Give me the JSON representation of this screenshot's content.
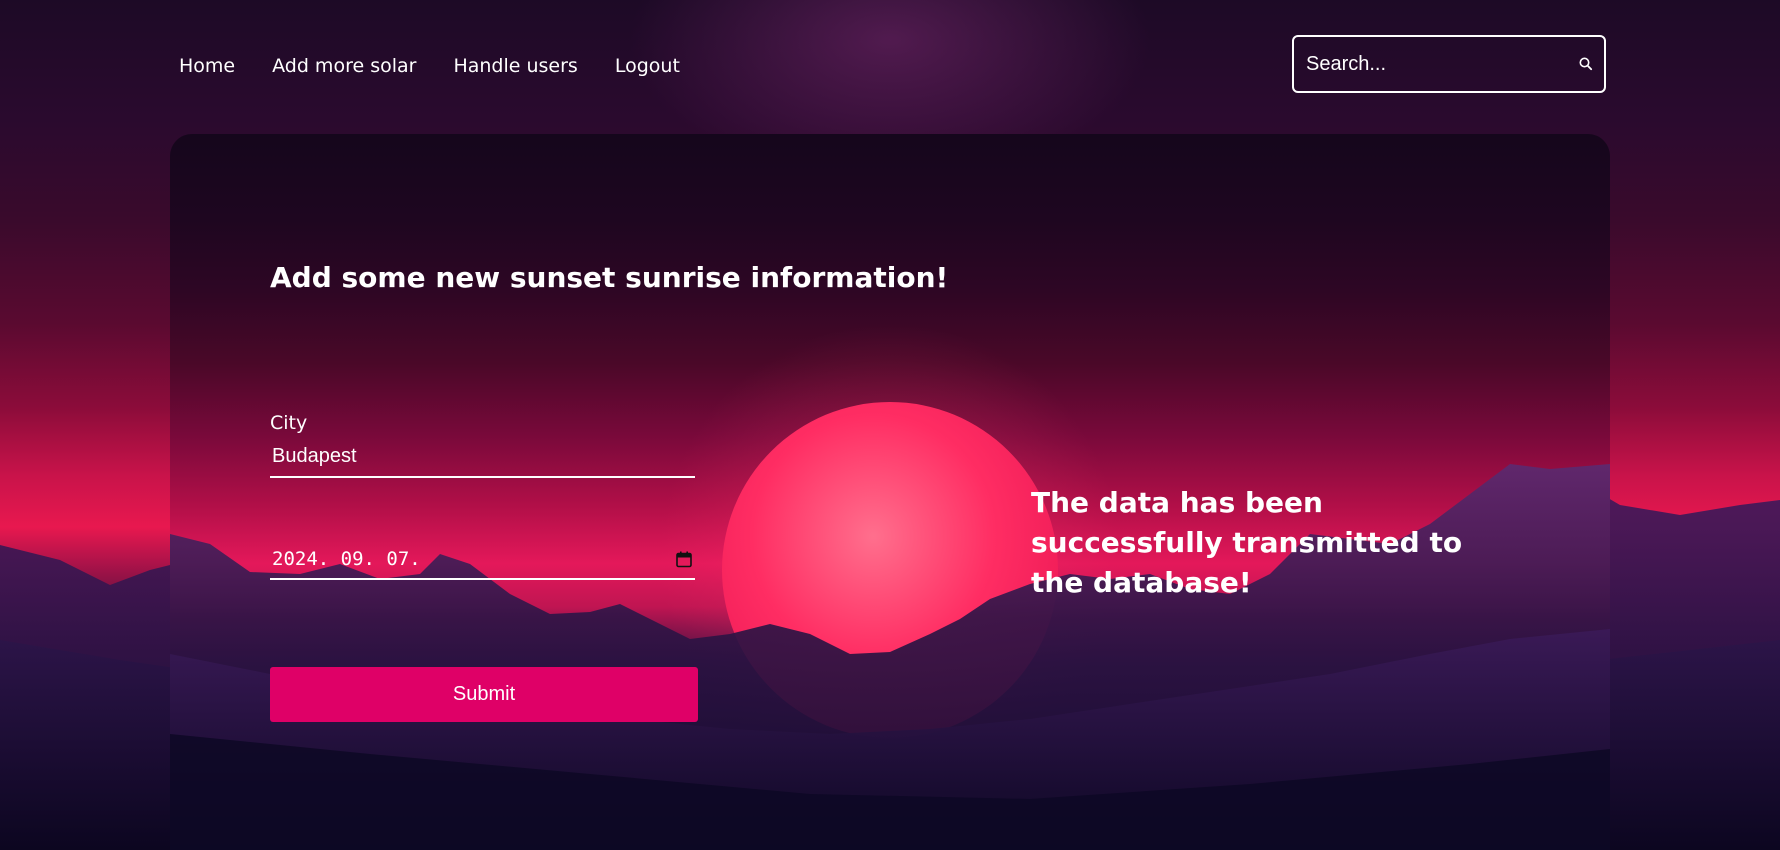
{
  "nav": {
    "links": [
      {
        "label": "Home"
      },
      {
        "label": "Add more solar"
      },
      {
        "label": "Handle users"
      },
      {
        "label": "Logout"
      }
    ]
  },
  "search": {
    "placeholder": "Search...",
    "icon": "search-icon"
  },
  "form": {
    "title": "Add some new sunset sunrise information!",
    "city_label": "City",
    "city_value": "Budapest",
    "date_value": "2024. 09. 07.",
    "date_icon": "calendar-icon",
    "submit_label": "Submit"
  },
  "status": {
    "message": "The data has been successfully transmitted to the database!"
  },
  "colors": {
    "accent": "#df0067",
    "sun": "#ff2d63",
    "background_dark": "#120624"
  }
}
